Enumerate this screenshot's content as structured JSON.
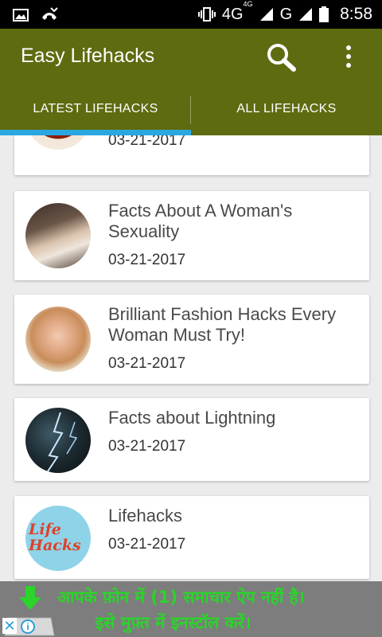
{
  "status_bar": {
    "network_label": "4G",
    "network_sup": "4G",
    "carrier2": "G",
    "time": "8:58",
    "icons": [
      "image-icon",
      "missed-call-icon",
      "vibrate-icon",
      "signal-icon",
      "battery-icon"
    ]
  },
  "app_bar": {
    "title": "Easy Lifehacks",
    "search_icon": "search-icon",
    "menu_icon": "overflow-menu-icon"
  },
  "tabs": [
    {
      "label": "LATEST LIFEHACKS",
      "selected": true
    },
    {
      "label": "ALL LIFEHACKS",
      "selected": false
    }
  ],
  "articles": [
    {
      "title": "",
      "date": "03-21-2017"
    },
    {
      "title": "Facts About A Woman's Sexuality",
      "date": "03-21-2017"
    },
    {
      "title": "Brilliant Fashion Hacks Every Woman Must Try!",
      "date": "03-21-2017"
    },
    {
      "title": "Facts about Lightning",
      "date": "03-21-2017"
    },
    {
      "title": "Lifehacks",
      "date": "03-21-2017",
      "thumb_text_1": "Life",
      "thumb_text_2": "Hacks"
    }
  ],
  "ad": {
    "line1": "आपके फ़ोन में (1) समाचार ऐप नहीं है।",
    "line2": "इसे मुफ़्त में इनस्टॉल करें।",
    "close_label": "✕",
    "info_label": "i"
  },
  "colors": {
    "app_bar": "#5f6b10",
    "tab_indicator": "#2aa7e0",
    "ad_text": "#2bd32b"
  }
}
